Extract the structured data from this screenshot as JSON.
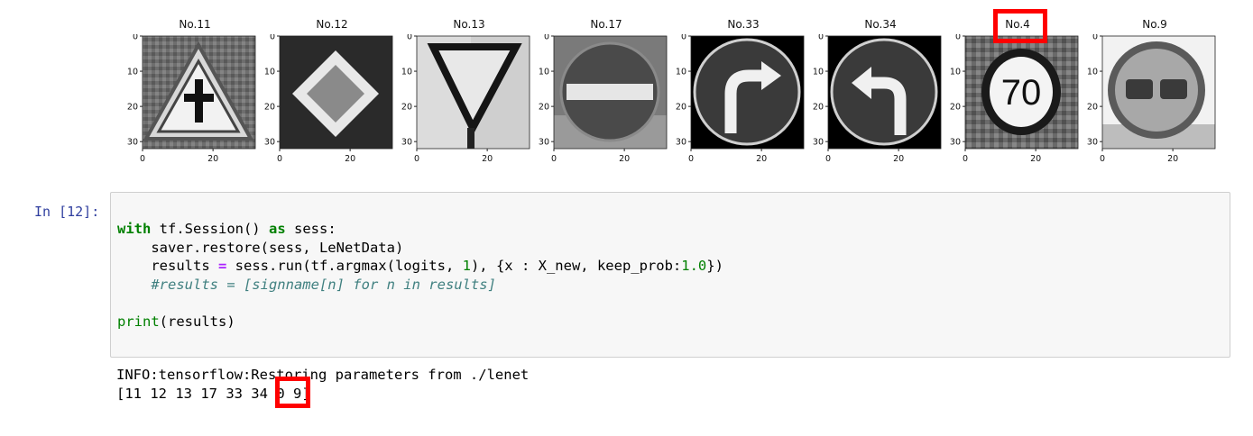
{
  "figure": {
    "panels": [
      {
        "title": "No.11",
        "sign": "triangle-crossroad"
      },
      {
        "title": "No.12",
        "sign": "priority-road"
      },
      {
        "title": "No.13",
        "sign": "yield"
      },
      {
        "title": "No.17",
        "sign": "no-entry"
      },
      {
        "title": "No.33",
        "sign": "turn-right-ahead"
      },
      {
        "title": "No.34",
        "sign": "turn-left-ahead"
      },
      {
        "title": "No.4",
        "sign": "speed-limit-70",
        "highlighted": true
      },
      {
        "title": "No.9",
        "sign": "no-passing"
      }
    ],
    "yticks": [
      "0",
      "10",
      "20",
      "30"
    ],
    "xticks": [
      "0",
      "20"
    ],
    "speed_label": "70"
  },
  "cell": {
    "prompt": "In [12]:",
    "code": {
      "l1_kw": "with",
      "l1_rest": " tf.Session() ",
      "l1_as": "as",
      "l1_end": " sess:",
      "l2": "    saver.restore(sess, LeNetData)",
      "l3_a": "    results ",
      "l3_op": "=",
      "l3_b": " sess.run(tf.argmax(logits, ",
      "l3_n1": "1",
      "l3_c": "), {x : X_new, keep_prob:",
      "l3_n2": "1.0",
      "l3_d": "})",
      "l4": "    #results = [signname[n] for n in results]",
      "l6_fn": "print",
      "l6_rest": "(results)"
    }
  },
  "output": {
    "line1": "INFO:tensorflow:Restoring parameters from ./lenet",
    "line2_prefix": "[11 12 13 17 33 34 ",
    "line2_highlight": "0",
    "line2_suffix": " 9]"
  },
  "colors": {
    "highlight": "#ff0000",
    "prompt": "#303f9f",
    "keyword": "#008000",
    "comment": "#408080",
    "operator": "#aa22ff"
  }
}
